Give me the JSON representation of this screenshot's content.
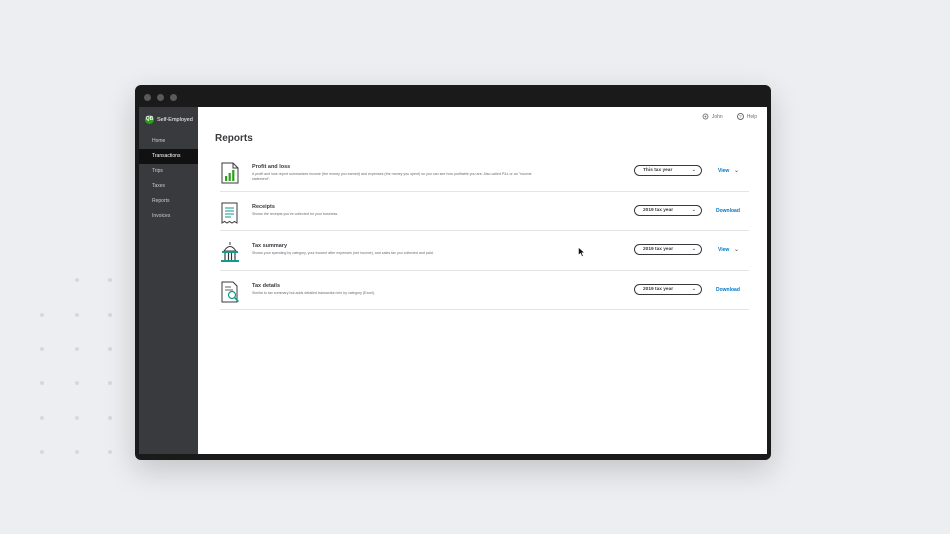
{
  "app": {
    "brand_badge": "QB",
    "brand_name": "Self-Employed"
  },
  "sidebar": {
    "items": [
      {
        "label": "Home",
        "active": false
      },
      {
        "label": "Transactions",
        "active": true
      },
      {
        "label": "Trips",
        "active": false
      },
      {
        "label": "Taxes",
        "active": false
      },
      {
        "label": "Reports",
        "active": false
      },
      {
        "label": "Invoices",
        "active": false
      }
    ]
  },
  "topbar": {
    "user_label": "John",
    "help_label": "Help",
    "help_icon_glyph": "?"
  },
  "page": {
    "title": "Reports"
  },
  "reports": [
    {
      "icon": "profit-loss-chart-icon",
      "title": "Profit and loss",
      "description": "A profit and loss report summarizes income (the money you earned) and expenses (the money you spent) so you can see how profitable you are. Also called P&L or an \"income statement\".",
      "select_value": "This tax year",
      "action_label": "View",
      "has_chevron": true
    },
    {
      "icon": "receipt-icon",
      "title": "Receipts",
      "description": "Shows the receipts you've collected for your business.",
      "select_value": "2019 tax year",
      "action_label": "Download",
      "has_chevron": false
    },
    {
      "icon": "government-building-icon",
      "title": "Tax summary",
      "description": "Shows your spending by category, your income after expenses (net income), and sales tax you collected and paid.",
      "select_value": "2019 tax year",
      "action_label": "View",
      "has_chevron": true
    },
    {
      "icon": "document-search-icon",
      "title": "Tax details",
      "description": "Similar to tax summary but adds detailed transaction info by category (Excel).",
      "select_value": "2019 tax year",
      "action_label": "Download",
      "has_chevron": false
    }
  ],
  "colors": {
    "brand": "#2ca01c",
    "link": "#0077c5",
    "sidebar": "#393a3d",
    "icon_teal": "#0c9d8b"
  }
}
